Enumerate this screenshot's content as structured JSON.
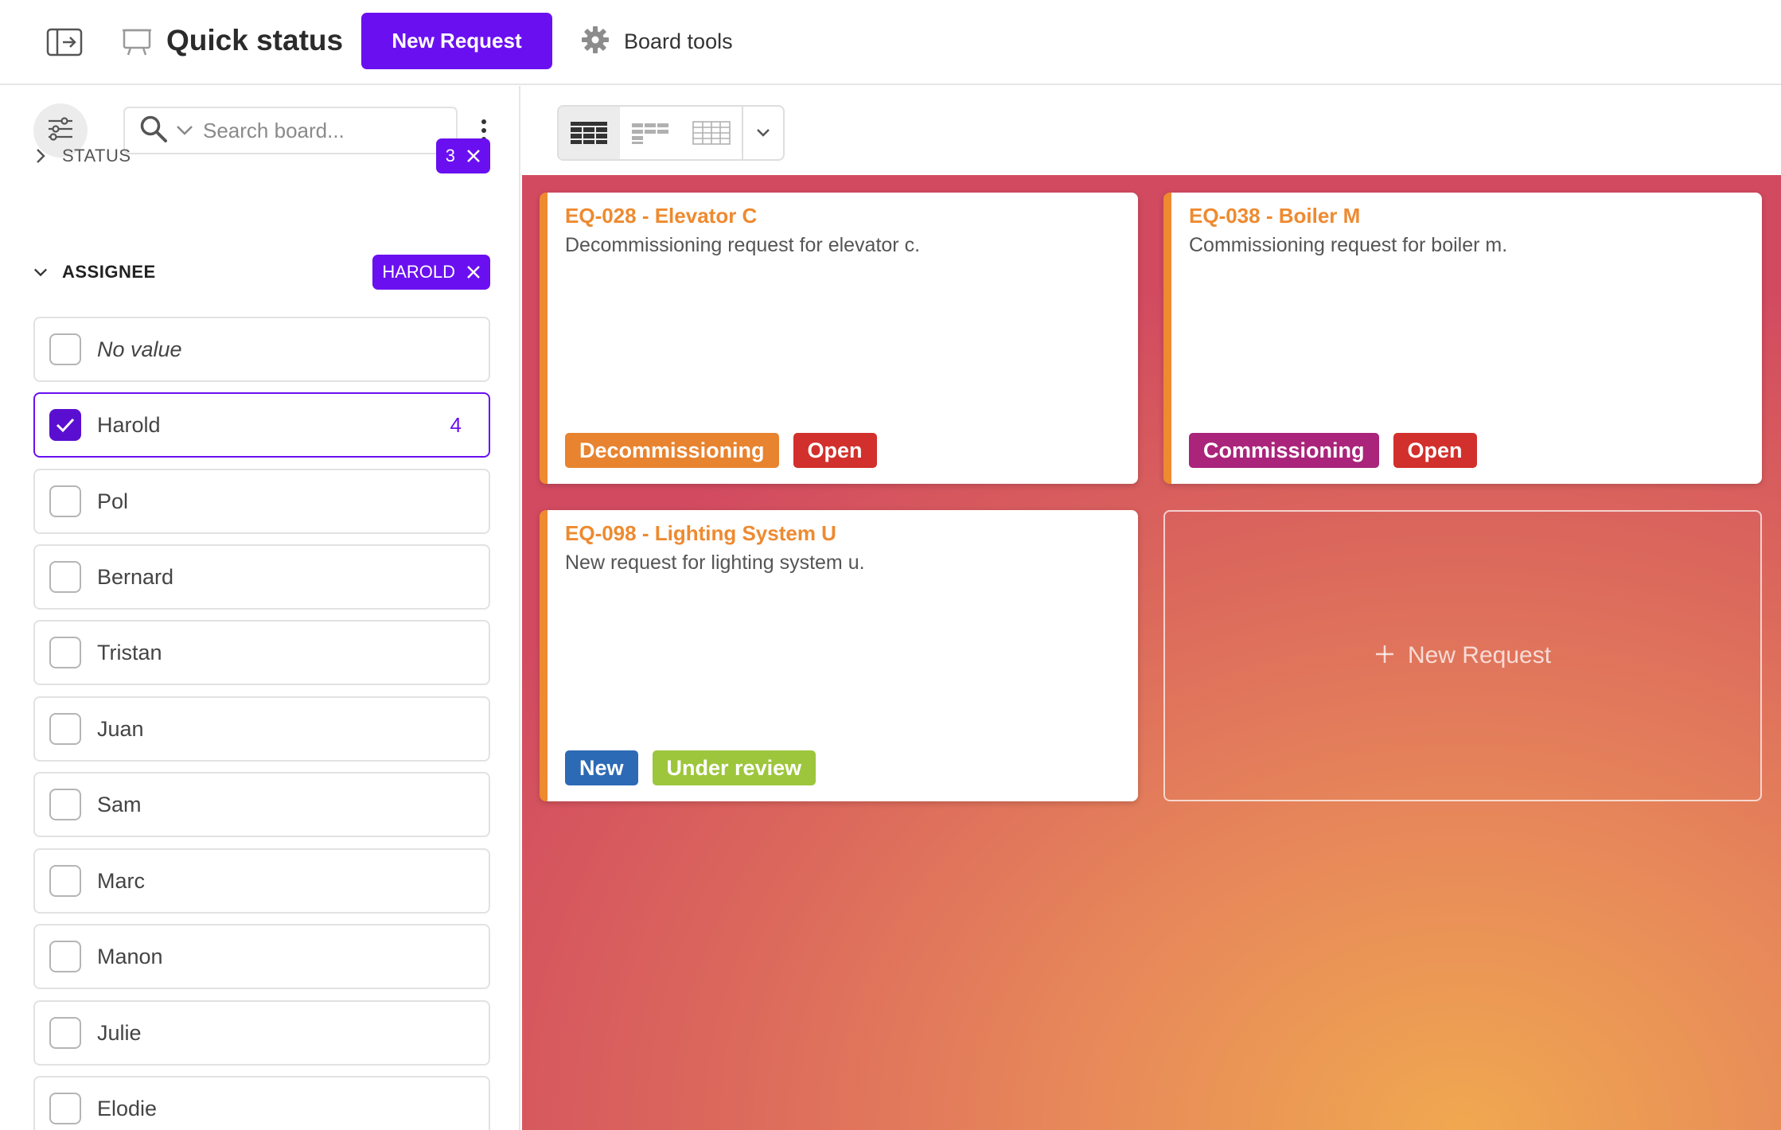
{
  "topbar": {
    "title": "Quick status",
    "new_request_label": "New Request",
    "board_tools_label": "Board tools"
  },
  "sidebar": {
    "search": {
      "placeholder": "Search board..."
    },
    "status_section": {
      "title": "STATUS",
      "expanded": false,
      "chip_value": "3"
    },
    "assignee_section": {
      "title": "ASSIGNEE",
      "expanded": true,
      "chip_value": "HAROLD"
    },
    "assignee_options": [
      {
        "label": "No value",
        "checked": false,
        "count": ""
      },
      {
        "label": "Harold",
        "checked": true,
        "count": "4"
      },
      {
        "label": "Pol",
        "checked": false,
        "count": ""
      },
      {
        "label": "Bernard",
        "checked": false,
        "count": ""
      },
      {
        "label": "Tristan",
        "checked": false,
        "count": ""
      },
      {
        "label": "Juan",
        "checked": false,
        "count": ""
      },
      {
        "label": "Sam",
        "checked": false,
        "count": ""
      },
      {
        "label": "Marc",
        "checked": false,
        "count": ""
      },
      {
        "label": "Manon",
        "checked": false,
        "count": ""
      },
      {
        "label": "Julie",
        "checked": false,
        "count": ""
      },
      {
        "label": "Elodie",
        "checked": false,
        "count": ""
      }
    ]
  },
  "view_switcher": {
    "active": "grid-view",
    "options": [
      "grid-view",
      "compact-view",
      "table-view"
    ]
  },
  "cards": [
    {
      "title": "EQ-028 - Elevator C",
      "description": "Decommissioning request for elevator c.",
      "tags": [
        {
          "label": "Decommissioning",
          "color": "#e8832f"
        },
        {
          "label": "Open",
          "color": "#d2302c"
        }
      ]
    },
    {
      "title": "EQ-038 - Boiler M",
      "description": "Commissioning request for boiler m.",
      "tags": [
        {
          "label": "Commissioning",
          "color": "#a9247a"
        },
        {
          "label": "Open",
          "color": "#d2302c"
        }
      ]
    },
    {
      "title": "EQ-098 - Lighting System U",
      "description": "New request for lighting system u.",
      "tags": [
        {
          "label": "New",
          "color": "#2d6ab5"
        },
        {
          "label": "Under review",
          "color": "#9dc63c"
        }
      ]
    }
  ],
  "new_card_placeholder": {
    "label": "New Request"
  },
  "colors": {
    "accent": "#6a10f0",
    "card_title": "#ee8a30",
    "card_border": "#ee8a30"
  }
}
